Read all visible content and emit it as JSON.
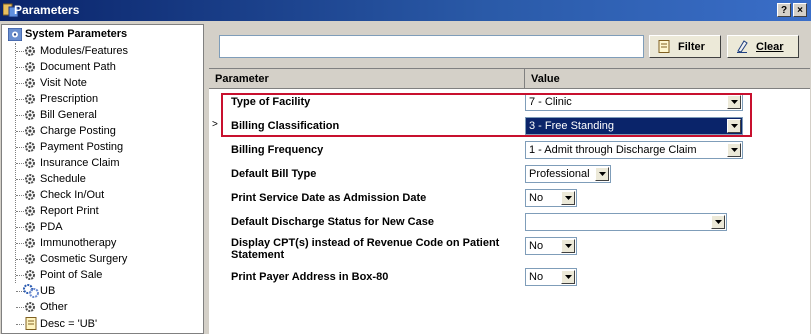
{
  "window": {
    "title": "Parameters",
    "help_button": "?",
    "close_button": "×"
  },
  "tree": {
    "root_label": "System Parameters",
    "items": [
      {
        "label": "Modules/Features"
      },
      {
        "label": "Document Path"
      },
      {
        "label": "Visit Note"
      },
      {
        "label": "Prescription"
      },
      {
        "label": "Bill General"
      },
      {
        "label": "Charge Posting"
      },
      {
        "label": "Payment Posting"
      },
      {
        "label": "Insurance Claim"
      },
      {
        "label": "Schedule"
      },
      {
        "label": "Check In/Out"
      },
      {
        "label": "Report Print"
      },
      {
        "label": "PDA"
      },
      {
        "label": "Immunotherapy"
      },
      {
        "label": "Cosmetic Surgery"
      },
      {
        "label": "Point of Sale"
      },
      {
        "label": "UB"
      },
      {
        "label": "Other"
      }
    ],
    "filter_node_label": "Desc = 'UB'"
  },
  "filter": {
    "input_value": "",
    "filter_label": "Filter",
    "clear_label": "Clear"
  },
  "grid": {
    "headers": {
      "parameter": "Parameter",
      "value": "Value"
    },
    "rows": [
      {
        "parameter": "Type of Facility",
        "value": "7 - Clinic"
      },
      {
        "parameter": "Billing Classification",
        "value": "3 - Free Standing",
        "current": ">"
      },
      {
        "parameter": "Billing Frequency",
        "value": "1 - Admit through Discharge Claim"
      },
      {
        "parameter": "Default Bill Type",
        "value": "Professional"
      },
      {
        "parameter": "Print Service Date as Admission Date",
        "value": "No"
      },
      {
        "parameter": "Default Discharge Status for New Case",
        "value": ""
      },
      {
        "parameter": "Display CPT(s) instead of Revenue Code on Patient Statement",
        "value": "No"
      },
      {
        "parameter": "Print Payer Address in Box-80",
        "value": "No"
      }
    ]
  },
  "colors": {
    "highlight": "#c8102e",
    "selection": "#0a246a",
    "titlebar": "#0a246a"
  }
}
